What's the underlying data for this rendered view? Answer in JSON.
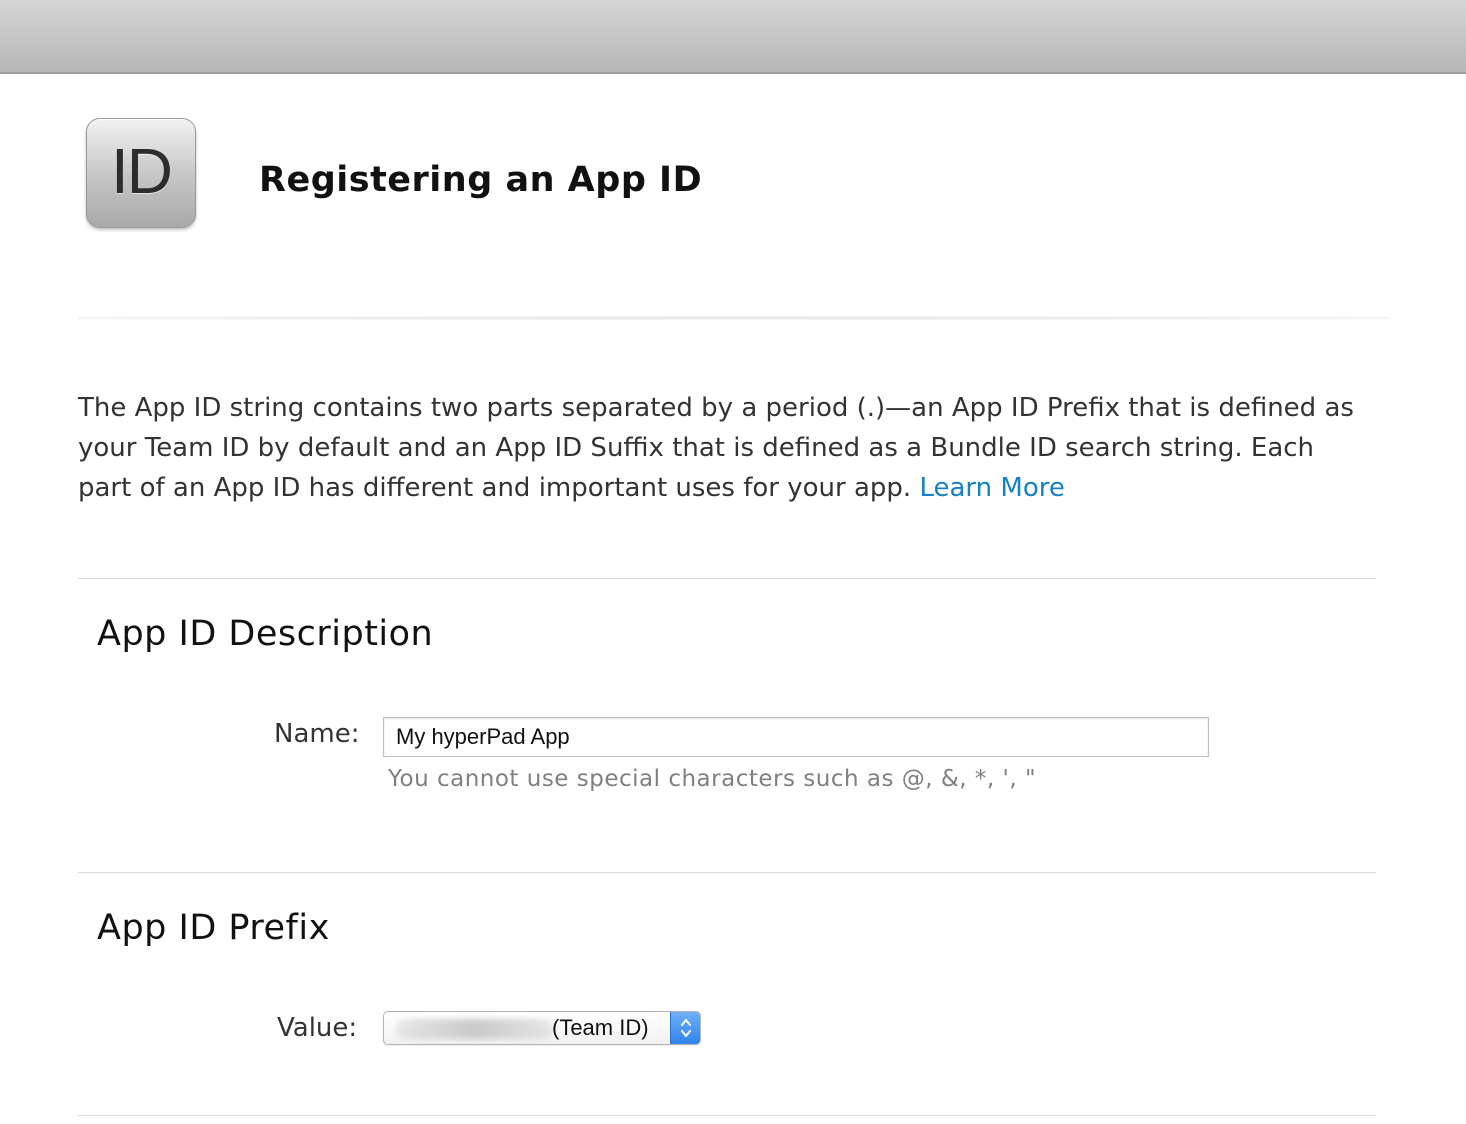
{
  "header": {
    "icon_text": "ID",
    "title": "Registering an App ID"
  },
  "intro": {
    "text": "The App ID string contains two parts separated by a period (.)—an App ID Prefix that is defined as your Team ID by default and an App ID Suffix that is defined as a Bundle ID search string. Each part of an App ID has different and important uses for your app.",
    "link_label": "Learn More"
  },
  "description_section": {
    "title": "App ID Description",
    "name_label": "Name:",
    "name_value": "My hyperPad App",
    "hint": "You cannot use special characters such as @, &, *, ', \""
  },
  "prefix_section": {
    "title": "App ID Prefix",
    "value_label": "Value:",
    "value_selected": "(Team ID)"
  },
  "colors": {
    "link": "#1581c7",
    "select_accent": "#2f84ea"
  },
  "icons": [
    "app-id-icon",
    "select-arrows-icon"
  ]
}
